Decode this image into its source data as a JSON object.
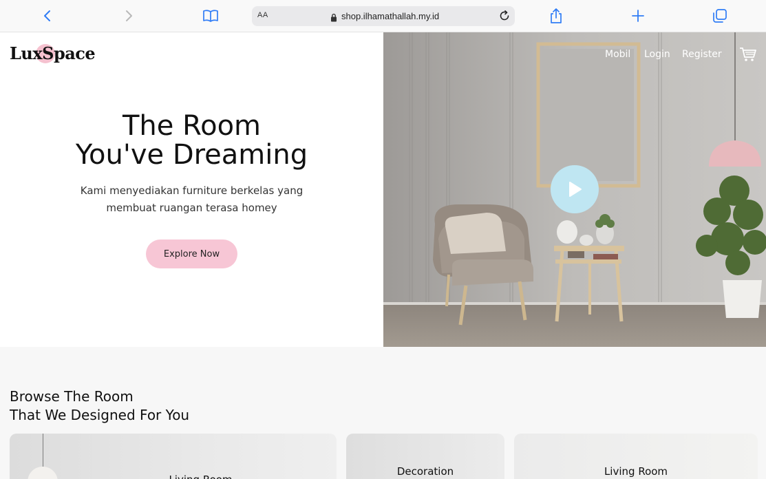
{
  "browser": {
    "text_size_label": "AA",
    "url": "shop.ilhamathallah.my.id",
    "icons": [
      "back-icon",
      "forward-icon",
      "bookmarks-icon",
      "lock-icon",
      "reload-icon",
      "share-icon",
      "new-tab-icon",
      "tabs-icon"
    ]
  },
  "brand": {
    "logo": "LuxSpace"
  },
  "nav": {
    "items": [
      "Mobil",
      "Login",
      "Register"
    ],
    "cart_icon": "cart-icon"
  },
  "hero": {
    "title_line1": "The Room",
    "title_line2": "You've Dreaming",
    "subtitle_line1": "Kami menyediakan furniture berkelas yang",
    "subtitle_line2": "membuat ruangan terasa homey",
    "cta": "Explore Now",
    "play_icon": "play-icon"
  },
  "browse": {
    "title_line1": "Browse The Room",
    "title_line2": "That We Designed For You",
    "cards": [
      "Living Room",
      "Decoration",
      "Living Room"
    ]
  },
  "colors": {
    "accent_pink": "#f7c6d5",
    "play_blue": "#bfe6f2",
    "logo_dot": "#f5c1cf"
  }
}
